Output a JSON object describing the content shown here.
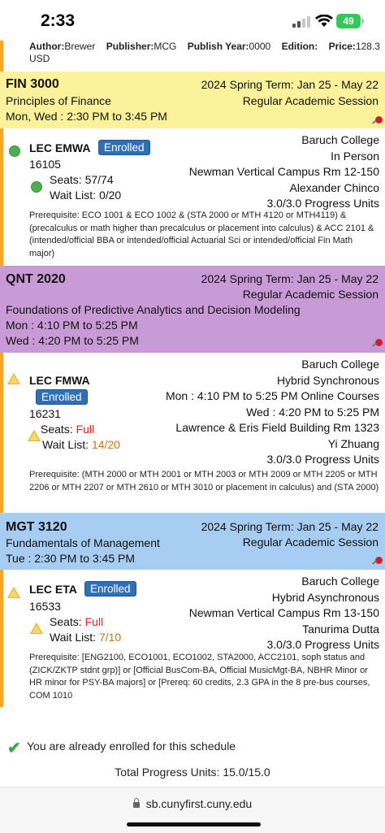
{
  "status_bar": {
    "time": "2:33",
    "battery": "49"
  },
  "book_info": {
    "author_label": "Author:",
    "author": "Brewer",
    "publisher_label": "Publisher:",
    "publisher": "MCG",
    "year_label": "Publish Year:",
    "year": "0000",
    "edition_label": "Edition:",
    "price_label": "Price:",
    "price": "128.3",
    "currency": "USD"
  },
  "courses": [
    {
      "code": "FIN 3000",
      "title": "Principles of Finance",
      "schedule": [
        "Mon, Wed : 2:30 PM to 3:45 PM"
      ],
      "term": "2024 Spring Term: Jan 25 - May 22",
      "session": "Regular Academic Session",
      "header_color": "#fbf29b",
      "section": {
        "type": "LEC EMWA",
        "status": "Enrolled",
        "class_number": "16105",
        "seats_label": "Seats:",
        "seats": "57/74",
        "waitlist_label": "Wait List:",
        "waitlist": "0/20",
        "right_lines": [
          "Baruch College",
          "In Person",
          "Newman Vertical Campus Rm 12-150",
          "Alexander Chinco",
          "3.0/3.0 Progress Units"
        ],
        "prereq": "Prerequisite: ECO 1001 & ECO 1002 & (STA 2000 or MTH 4120 or MTH4119) & (precalculus or math higher than precalculus or placement into calculus) & ACC 2101 & (intended/official BBA or intended/official Actuarial Sci or intended/official Fin Math major)"
      }
    },
    {
      "code": "QNT 2020",
      "title": "Foundations of Predictive Analytics and Decision Modeling",
      "schedule": [
        "Mon : 4:10 PM to 5:25 PM",
        "Wed : 4:20 PM to 5:25 PM"
      ],
      "term": "2024 Spring Term: Jan 25 - May 22",
      "session": "Regular Academic Session",
      "header_color": "#c99bd6",
      "section": {
        "type": "LEC FMWA",
        "status": "Enrolled",
        "class_number": "16231",
        "seats_label": "Seats:",
        "seats": "Full",
        "waitlist_label": "Wait List:",
        "waitlist": "14/20",
        "right_lines": [
          "Baruch College",
          "Hybrid Synchronous",
          "Mon : 4:10 PM to 5:25 PM Online Courses",
          "Wed : 4:20 PM to 5:25 PM",
          "Lawrence & Eris Field Building Rm 1323",
          "Yi Zhuang",
          "3.0/3.0 Progress Units"
        ],
        "prereq": "Prerequisite: (MTH 2000 or MTH 2001 or MTH 2003 or MTH 2009 or MTH 2205 or MTH 2206 or MTH 2207 or MTH 2610 or MTH 3010 or placement in calculus) and (STA 2000)"
      }
    },
    {
      "code": "MGT 3120",
      "title": "Fundamentals of Management",
      "schedule": [
        "Tue : 2:30 PM to 3:45 PM"
      ],
      "term": "2024 Spring Term: Jan 25 - May 22",
      "session": "Regular Academic Session",
      "header_color": "#a8cdf3",
      "section": {
        "type": "LEC ETA",
        "status": "Enrolled",
        "class_number": "16533",
        "seats_label": "Seats:",
        "seats": "Full",
        "waitlist_label": "Wait List:",
        "waitlist": "7/10",
        "right_lines": [
          "Baruch College",
          "Hybrid Asynchronous",
          "Newman Vertical Campus Rm 13-150",
          "Tanurima Dutta",
          "3.0/3.0 Progress Units"
        ],
        "prereq": "Prerequisite: [ENG2100, ECO1001, ECO1002, STA2000, ACC2101, soph status and (ZICK/ZKTP stdnt grp)] or [Official BusCom-BA, Official MusicMgt-BA, NBHR Minor or HR minor for PSY-BA majors] or [Prereq: 60 credits, 2.3 GPA in the 8 pre-bus courses, COM 1010"
      }
    }
  ],
  "footer": {
    "enrolled_message": "You are already enrolled for this schedule",
    "total_units": "Total Progress Units: 15.0/15.0"
  },
  "browser": {
    "url": "sb.cunyfirst.cuny.edu"
  }
}
